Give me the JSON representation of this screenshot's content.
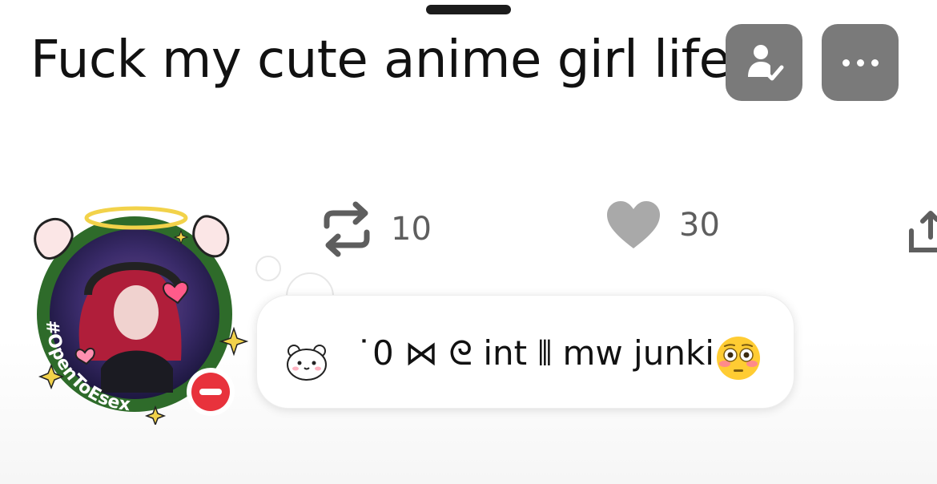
{
  "post": {
    "text": "Fuck my cute anime girl life"
  },
  "header": {
    "follow_icon": "person-check-icon",
    "more_icon": "more-dots-icon"
  },
  "actions": {
    "repost_count": "10",
    "like_count": "30",
    "repost_icon": "repost-icon",
    "like_icon": "heart-icon",
    "share_icon": "share-icon"
  },
  "avatar": {
    "badge_text": "#OpenToEsex",
    "status_indicator": "do-not-disturb-icon"
  },
  "status": {
    "text": "˙0 ⋈ ᘓ int ⫴ mw junki",
    "emoji": "flushed-face-icon",
    "sticker": "bear-face-icon"
  },
  "colors": {
    "button_gray": "#7a7a7a",
    "action_gray": "#5e5e5e",
    "badge_green": "#2e6b2a",
    "dnd_red": "#e8323c",
    "halo_gold": "#f2d24a"
  }
}
